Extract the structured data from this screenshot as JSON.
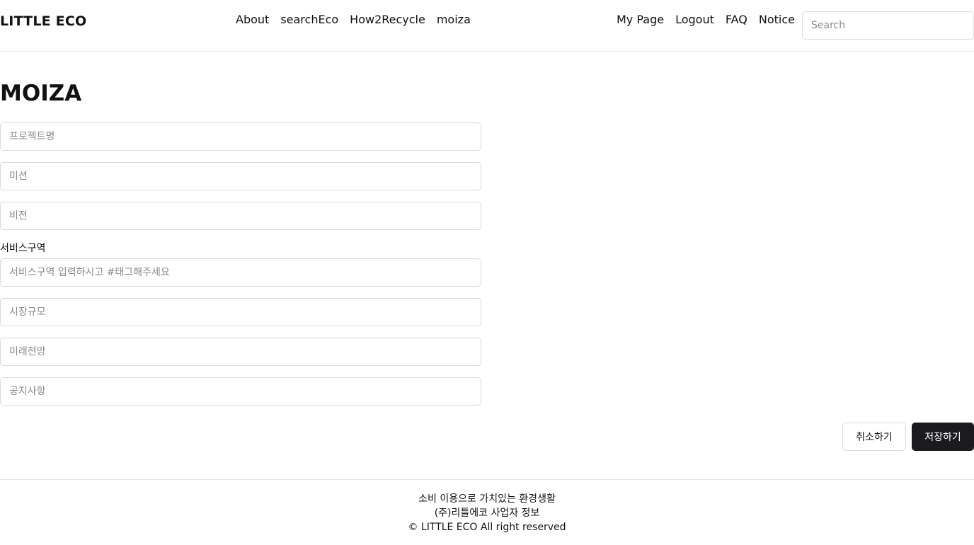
{
  "header": {
    "brand": "LITTLE ECO",
    "nav_center": [
      "About",
      "searchEco",
      "How2Recycle",
      "moiza"
    ],
    "nav_right": [
      "My Page",
      "Logout",
      "FAQ",
      "Notice"
    ],
    "search_placeholder": "Search"
  },
  "main": {
    "title": "MOIZA",
    "fields": {
      "project_name_placeholder": "프로젝트명",
      "mission_placeholder": "미션",
      "vision_placeholder": "비전",
      "service_area_label": "서비스구역",
      "service_area_placeholder": "서비스구역 입력하시고 #태그해주세요",
      "market_size_placeholder": "시장규모",
      "future_outlook_placeholder": "미래전망",
      "notice_placeholder": "공지사항"
    },
    "buttons": {
      "cancel": "취소하기",
      "save": "저장하기"
    }
  },
  "footer": {
    "line1": "소비 이용으로 가치있는 환경생활",
    "line2": "(주)리틀에코 사업자 정보",
    "line3": "© LITTLE ECO All right reserved"
  }
}
